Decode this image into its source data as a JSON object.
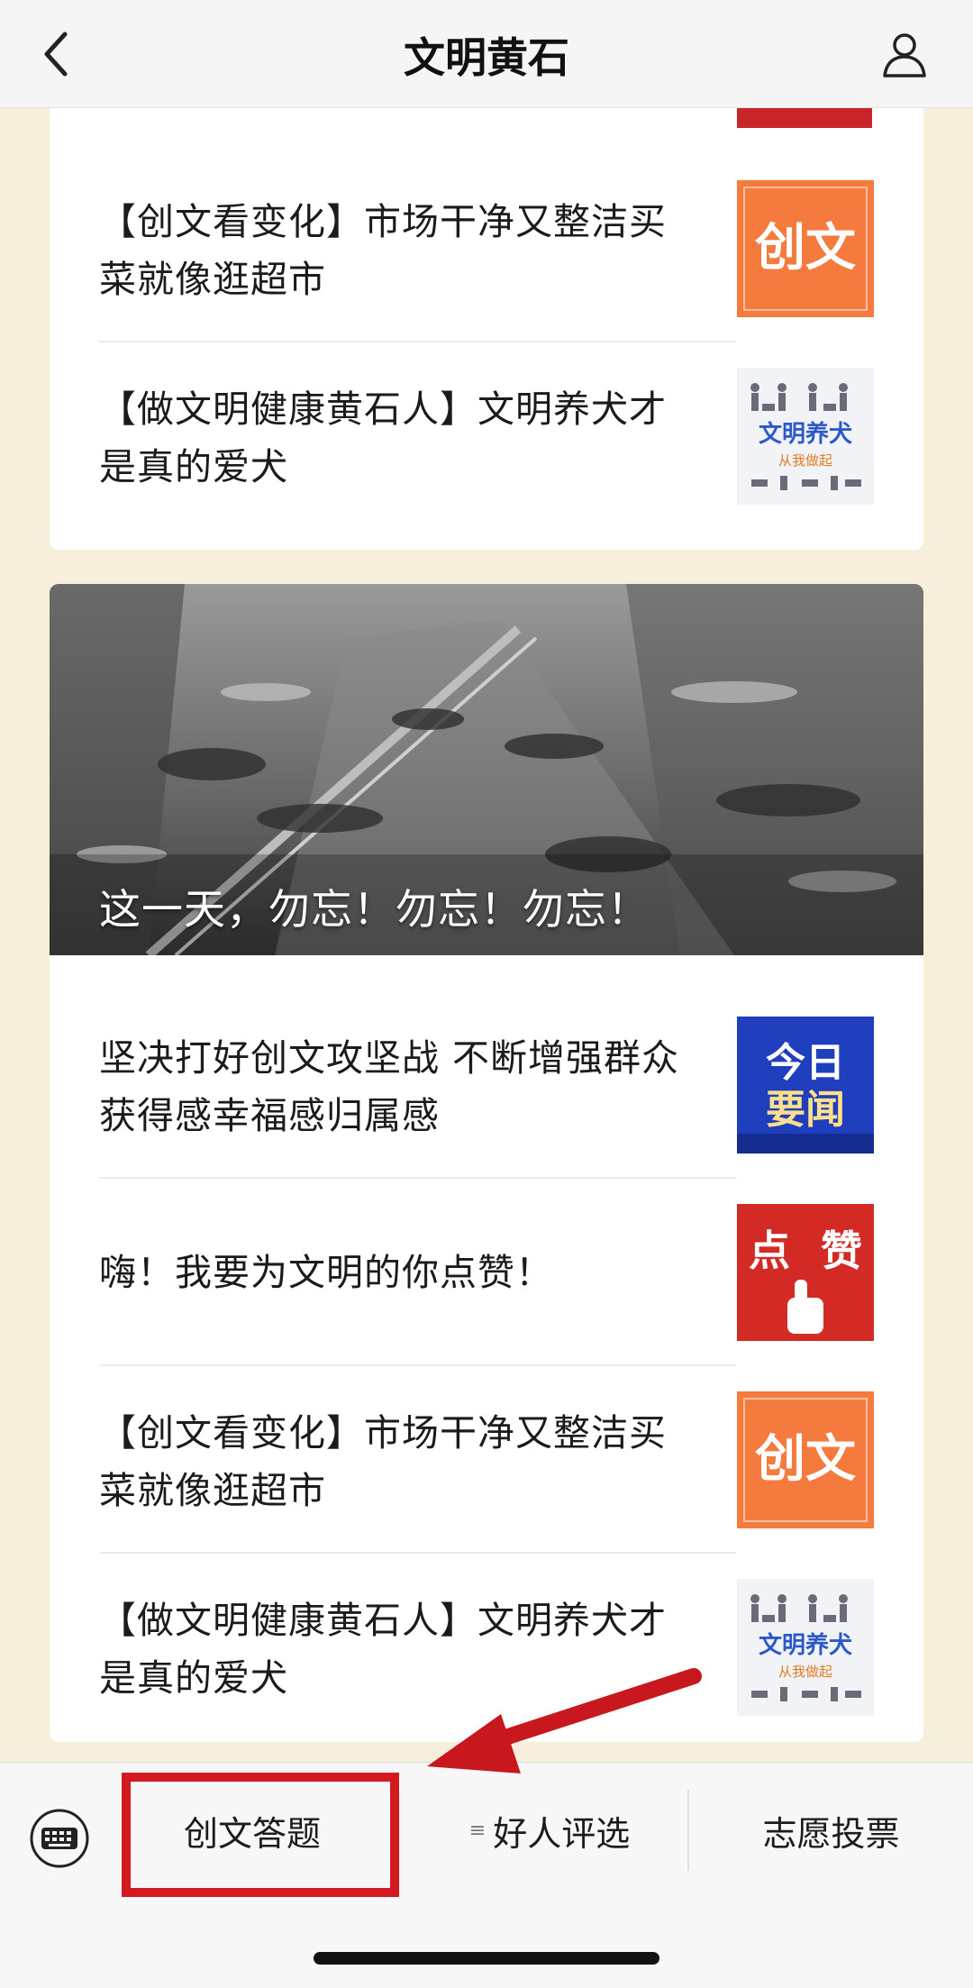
{
  "nav": {
    "title": "文明黄石"
  },
  "top_articles": [
    {
      "title": "【创文看变化】市场干净又整洁买菜就像逛超市",
      "thumb_text": "创文",
      "thumb_color": "#f47b3d"
    },
    {
      "title": "【做文明健康黄石人】文明养犬才是真的爱犬",
      "thumb_text": "文明养犬",
      "thumb_sub": "从我做起"
    }
  ],
  "hero": {
    "caption": "这一天，勿忘！勿忘！勿忘！"
  },
  "main_articles": [
    {
      "title": "坚决打好创文攻坚战 不断增强群众获得感幸福感归属感",
      "thumb_text_1": "今日",
      "thumb_text_2": "要闻",
      "thumb_color": "#1f3fbf"
    },
    {
      "title": "嗨！我要为文明的你点赞！",
      "thumb_text_1": "点",
      "thumb_text_2": "赞",
      "thumb_color": "#d42a26"
    },
    {
      "title": "【创文看变化】市场干净又整洁买菜就像逛超市",
      "thumb_text": "创文",
      "thumb_color": "#f47b3d"
    },
    {
      "title": "【做文明健康黄石人】文明养犬才是真的爱犬",
      "thumb_text": "文明养犬",
      "thumb_sub": "从我做起"
    }
  ],
  "tabbar": {
    "items": [
      {
        "label": "创文答题"
      },
      {
        "label": "好人评选"
      },
      {
        "label": "志愿投票"
      }
    ]
  },
  "colors": {
    "highlight_box": "#d21a20",
    "arrow": "#c8181e",
    "page_bg": "#f6efdc"
  }
}
